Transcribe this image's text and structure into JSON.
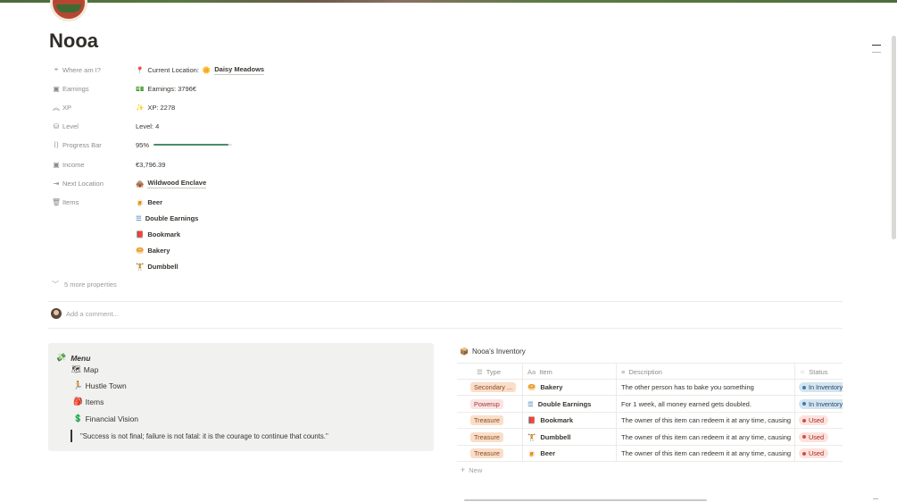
{
  "page": {
    "title": "Nooa",
    "colors": {
      "accent_green": "#4b8c67",
      "tag_orange_bg": "#fadec9",
      "status_blue_bg": "#d3e5ef",
      "status_red_bg": "#ffe2dd"
    }
  },
  "properties": [
    {
      "key": "Where am I?",
      "key_icon": "pin-icon",
      "value_prefix": "Current Location:",
      "value_icon": "flower-icon",
      "value": "Daisy Meadows"
    },
    {
      "key": "Earnings",
      "key_icon": "money-icon",
      "value": "Earnings: 3796€",
      "value_icon": "cash-icon"
    },
    {
      "key": "XP",
      "key_icon": "chevrons-up-icon",
      "value": "XP: 2278",
      "value_icon": "sparkle-icon"
    },
    {
      "key": "Level",
      "key_icon": "chart-icon",
      "value": "Level: 4"
    },
    {
      "key": "Progress Bar",
      "key_icon": "formula-icon",
      "value": "95%",
      "progress": 0.95
    },
    {
      "key": "Income",
      "key_icon": "money-icon",
      "value": "€3,796.39"
    },
    {
      "key": "Next Location",
      "key_icon": "arrow-right-icon",
      "value": "Wildwood Enclave",
      "value_icon": "cabin-icon"
    },
    {
      "key": "Items",
      "key_icon": "trash-icon"
    }
  ],
  "items_list": [
    {
      "icon": "beer-icon",
      "label": "Beer"
    },
    {
      "icon": "layers-icon",
      "label": "Double Earnings"
    },
    {
      "icon": "book-icon",
      "label": "Bookmark"
    },
    {
      "icon": "bread-icon",
      "label": "Bakery"
    },
    {
      "icon": "dumbbell-icon",
      "label": "Dumbbell"
    }
  ],
  "more_properties": "5 more properties",
  "comment_placeholder": "Add a comment...",
  "callout": {
    "title": "Menu",
    "items": [
      {
        "icon": "map-icon",
        "label": "Map"
      },
      {
        "icon": "runner-icon",
        "label": "Hustle Town"
      },
      {
        "icon": "backpack-icon",
        "label": "Items"
      },
      {
        "icon": "vision-icon",
        "label": "Financial Vision"
      }
    ],
    "quote": "\"Success is not final; failure is not fatal: it is the courage to continue that counts.\""
  },
  "inventory": {
    "title": "Nooa's Inventory",
    "columns": [
      "Type",
      "Item",
      "Description",
      "Status"
    ],
    "rows": [
      {
        "type": "Secondary ...",
        "item": "Bakery",
        "item_icon": "bread-icon",
        "description": "The other person has to bake you something",
        "status": "In Inventory",
        "status_color": "blue",
        "type_color": "orange"
      },
      {
        "type": "Powerup",
        "item": "Double Earnings",
        "item_icon": "layers-icon",
        "description": "For 1 week, all money earned gets doubled.",
        "status": "In Inventory",
        "status_color": "blue",
        "type_color": "pink"
      },
      {
        "type": "Treasure",
        "item": "Bookmark",
        "item_icon": "book-icon",
        "description": "The owner of this item can redeem it at any time, causing",
        "status": "Used",
        "status_color": "red",
        "type_color": "orange"
      },
      {
        "type": "Treasure",
        "item": "Dumbbell",
        "item_icon": "dumbbell-icon",
        "description": "The owner of this item can redeem it at any time, causing",
        "status": "Used",
        "status_color": "red",
        "type_color": "orange"
      },
      {
        "type": "Treasure",
        "item": "Beer",
        "item_icon": "beer-icon",
        "description": "The owner of this item can redeem it at any time, causing",
        "status": "Used",
        "status_color": "red",
        "type_color": "orange"
      }
    ],
    "new_label": "New"
  }
}
